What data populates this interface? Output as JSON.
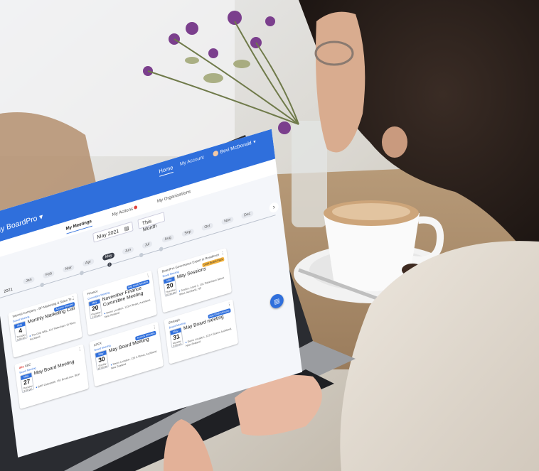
{
  "app": {
    "brand": "My BoardPro",
    "brand_caret": "▾"
  },
  "topnav": {
    "home": "Home",
    "account": "My Account",
    "user": "Bevi McDonald",
    "user_caret": "▾"
  },
  "tabs": [
    {
      "label": "My Meetings"
    },
    {
      "label": "My Actions"
    },
    {
      "label": "My Organisations"
    }
  ],
  "date_filter": {
    "value": "May 2021",
    "button": "This Month"
  },
  "timeline": {
    "year": "2021",
    "months": [
      "Jan",
      "Feb",
      "Mar",
      "Apr",
      "May",
      "Jun",
      "Jul",
      "Aug",
      "Sep",
      "Oct",
      "Nov",
      "Dec"
    ],
    "selected": "May",
    "selected_count": "2",
    "next_icon": "chevron-right-icon"
  },
  "cards": [
    {
      "org": "Internal Company - BP Marketing & Sales Te...",
      "type": "Board Meeting",
      "badge": "Access Minutes",
      "month": "May",
      "day": "4",
      "weekday": "Tuesday",
      "time": "9:00 am",
      "title": "Monthly Marketing Call",
      "location": "The Grid WBL, 101 Pakenham St West, Auckland"
    },
    {
      "org": "Finance",
      "type": "Committee Meeting",
      "badge": "Add Draft Minutes",
      "month": "May",
      "day": "20",
      "weekday": "Thursday",
      "time": "1:00 pm",
      "title": "November Finance Committee Meeting",
      "location": "Demo Location, 123 A Street, Auckland, New Zealand"
    },
    {
      "org": "BoardPro Governance Expert to Residence",
      "type": "Board Meeting",
      "badge": "Draft Board Pack",
      "month": "May",
      "day": "20",
      "weekday": "Thursday",
      "time": "10:30 am",
      "title": "May Sessions",
      "location": "Justice, Level 1, 101 Pakenham Street West, Auckland, NZ"
    },
    {
      "org": "ABC",
      "type": "Board Meeting",
      "badge": "",
      "month": "May",
      "day": "27",
      "weekday": "Thursday",
      "time": "2:00 pm",
      "title": "May Board Meeting",
      "location": "BDP Osteopath, 151 Broad Ave, BDP"
    },
    {
      "org": "APEX",
      "type": "Board Meeting",
      "badge": "Access Minutes",
      "month": "May",
      "day": "30",
      "weekday": "Sunday",
      "time": "10:00 am",
      "title": "May Board Meeting",
      "location": "Demo Location, 123 A Street, Auckland, New Zealand"
    },
    {
      "org": "Strategic",
      "type": "Board Meeting",
      "badge": "Add Draft Minutes",
      "month": "May",
      "day": "31",
      "weekday": "Monday",
      "time": "9:00 am",
      "title": "May Board meeting",
      "location": "Demo Location, 123 A Street, Auckland, New Zealand"
    }
  ],
  "fab": {
    "icon": "book-icon"
  },
  "colors": {
    "primary": "#2f6fdc",
    "accent_red": "#e0443e",
    "warn": "#f3b23b"
  }
}
